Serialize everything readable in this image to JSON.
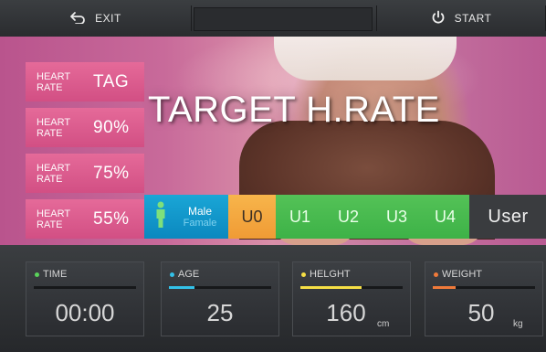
{
  "topbar": {
    "exit_label": "EXIT",
    "start_label": "START",
    "icons": {
      "exit": "back-arrow-icon",
      "start": "power-icon"
    }
  },
  "hero": {
    "title": "TARGET H.RATE",
    "heart_rate_buttons": [
      {
        "label": "HEART RATE",
        "value": "TAG"
      },
      {
        "label": "HEART RATE",
        "value": "90%"
      },
      {
        "label": "HEART RATE",
        "value": "75%"
      },
      {
        "label": "HEART RATE",
        "value": "55%"
      }
    ],
    "gender": {
      "male": "Male",
      "female": "Famale",
      "icon": "person-icon"
    },
    "user_buttons": [
      "U0",
      "U1",
      "U2",
      "U3",
      "U4"
    ],
    "user_label": "User"
  },
  "stats": [
    {
      "label": "TIME",
      "value": "00:00",
      "unit": "",
      "progress": 0.0,
      "color": "#5ad35b"
    },
    {
      "label": "AGE",
      "value": "25",
      "unit": "",
      "progress": 0.25,
      "color": "#33c1e8"
    },
    {
      "label": "HELGHT",
      "value": "160",
      "unit": "cm",
      "progress": 0.6,
      "color": "#f6df45"
    },
    {
      "label": "WEIGHT",
      "value": "50",
      "unit": "kg",
      "progress": 0.22,
      "color": "#f07a3a"
    }
  ],
  "colors": {
    "heart_rate_pink": "#e56a99",
    "gender_blue": "#1aa6d6",
    "u0_orange": "#f7b54b",
    "u_green": "#54c257"
  }
}
